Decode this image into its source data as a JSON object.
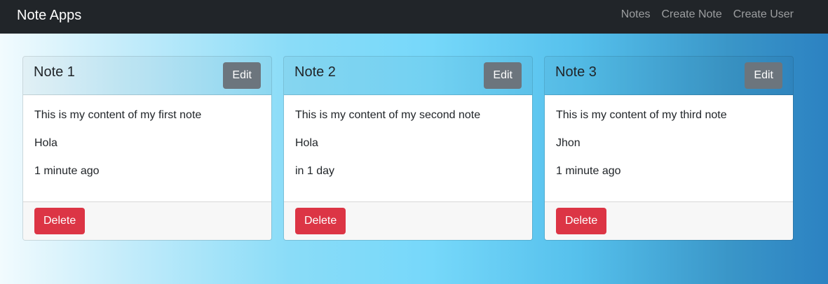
{
  "navbar": {
    "brand": "Note Apps",
    "links": [
      "Notes",
      "Create Note",
      "Create User"
    ]
  },
  "notes": [
    {
      "title": "Note 1",
      "content": "This is my content of my first note",
      "author": "Hola",
      "date": "1 minute ago",
      "edit_label": "Edit",
      "delete_label": "Delete"
    },
    {
      "title": "Note 2",
      "content": "This is my content of my second note",
      "author": "Hola",
      "date": "in 1 day",
      "edit_label": "Edit",
      "delete_label": "Delete"
    },
    {
      "title": "Note 3",
      "content": "This is my content of my third note",
      "author": "Jhon",
      "date": "1 minute ago",
      "edit_label": "Edit",
      "delete_label": "Delete"
    }
  ],
  "colors": {
    "navbar_bg": "#212529",
    "edit_button": "#6c757d",
    "delete_button": "#dc3545"
  }
}
